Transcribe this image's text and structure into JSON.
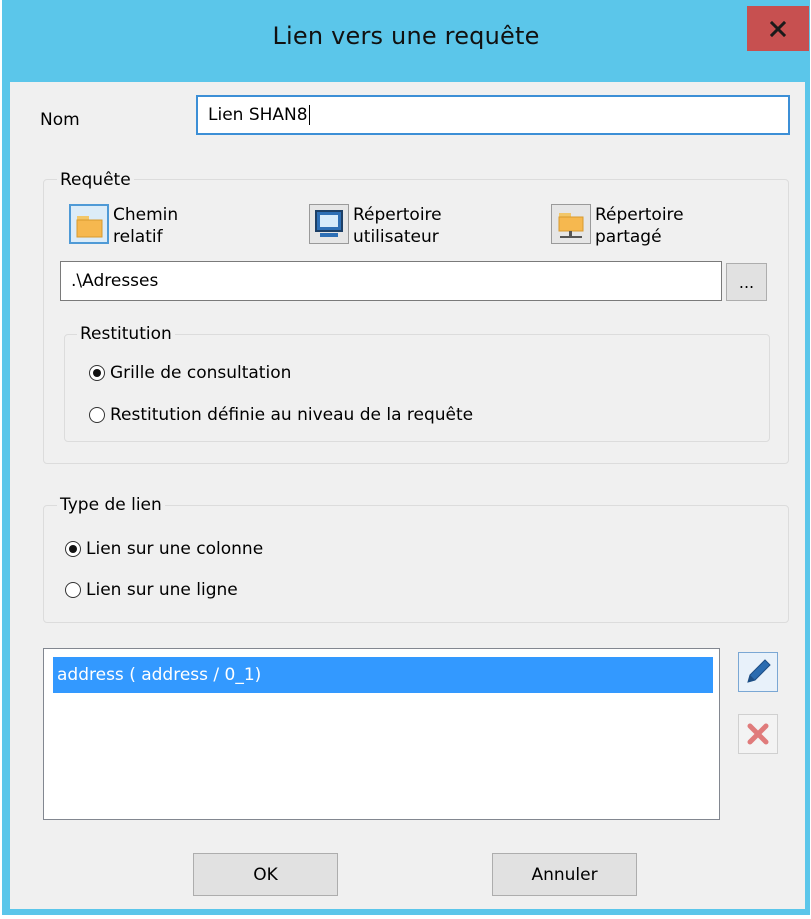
{
  "dialog": {
    "title": "Lien vers une requête",
    "close_icon": "close-icon"
  },
  "name_field": {
    "label": "Nom",
    "value": "Lien SHAN8"
  },
  "query_group": {
    "title": "Requête",
    "sources": [
      {
        "label": "Chemin\nrelatif",
        "icon": "folder-icon"
      },
      {
        "label": "Répertoire\nutilisateur",
        "icon": "monitor-icon"
      },
      {
        "label": "Répertoire\npartagé",
        "icon": "shared-folder-icon"
      }
    ],
    "path_value": ".\\Adresses",
    "browse_label": "...",
    "restitution": {
      "title": "Restitution",
      "options": [
        {
          "label": "Grille de consultation",
          "checked": true
        },
        {
          "label": "Restitution définie au niveau de la requête",
          "checked": false
        }
      ]
    }
  },
  "link_type": {
    "title": "Type de lien",
    "options": [
      {
        "label": "Lien sur une colonne",
        "checked": true
      },
      {
        "label": "Lien sur une ligne",
        "checked": false
      }
    ]
  },
  "links_list": {
    "items": [
      {
        "label": "address ( address / 0_1)",
        "selected": true
      }
    ],
    "edit_icon": "pencil-icon",
    "delete_icon": "delete-icon"
  },
  "buttons": {
    "ok": "OK",
    "cancel": "Annuler"
  },
  "colors": {
    "titlebar": "#5bc6ea",
    "close": "#c75050",
    "selection": "#3399ff",
    "focus_border": "#3c8fd6"
  }
}
